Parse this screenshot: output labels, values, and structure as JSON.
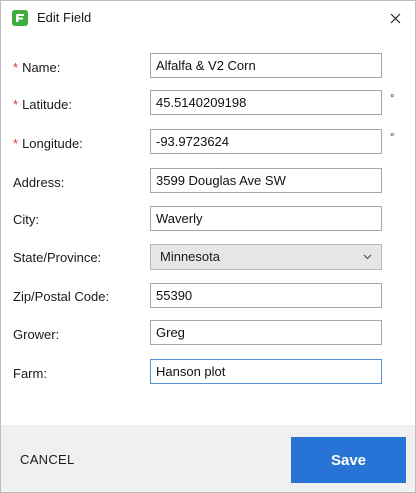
{
  "window": {
    "title": "Edit Field",
    "app_icon": "app-logo-icon",
    "close_icon": "close-icon",
    "accent_color": "#2773d6",
    "required_color": "#d03a2f"
  },
  "form": {
    "required_marker": "*",
    "degree_marker": "°",
    "name": {
      "label": "Name:",
      "required": true,
      "value": "Alfalfa & V2 Corn"
    },
    "latitude": {
      "label": "Latitude:",
      "required": true,
      "value": "45.5140209198"
    },
    "longitude": {
      "label": "Longitude:",
      "required": true,
      "value": "-93.9723624"
    },
    "address": {
      "label": "Address:",
      "required": false,
      "value": "3599 Douglas Ave SW"
    },
    "city": {
      "label": "City:",
      "required": false,
      "value": "Waverly"
    },
    "state": {
      "label": "State/Province:",
      "required": false,
      "value": "Minnesota",
      "icon": "chevron-down-icon"
    },
    "zip": {
      "label": "Zip/Postal Code:",
      "required": false,
      "value": "55390"
    },
    "grower": {
      "label": "Grower:",
      "required": false,
      "value": "Greg"
    },
    "farm": {
      "label": "Farm:",
      "required": false,
      "value": "Hanson plot"
    }
  },
  "footer": {
    "cancel_label": "CANCEL",
    "save_label": "Save"
  }
}
